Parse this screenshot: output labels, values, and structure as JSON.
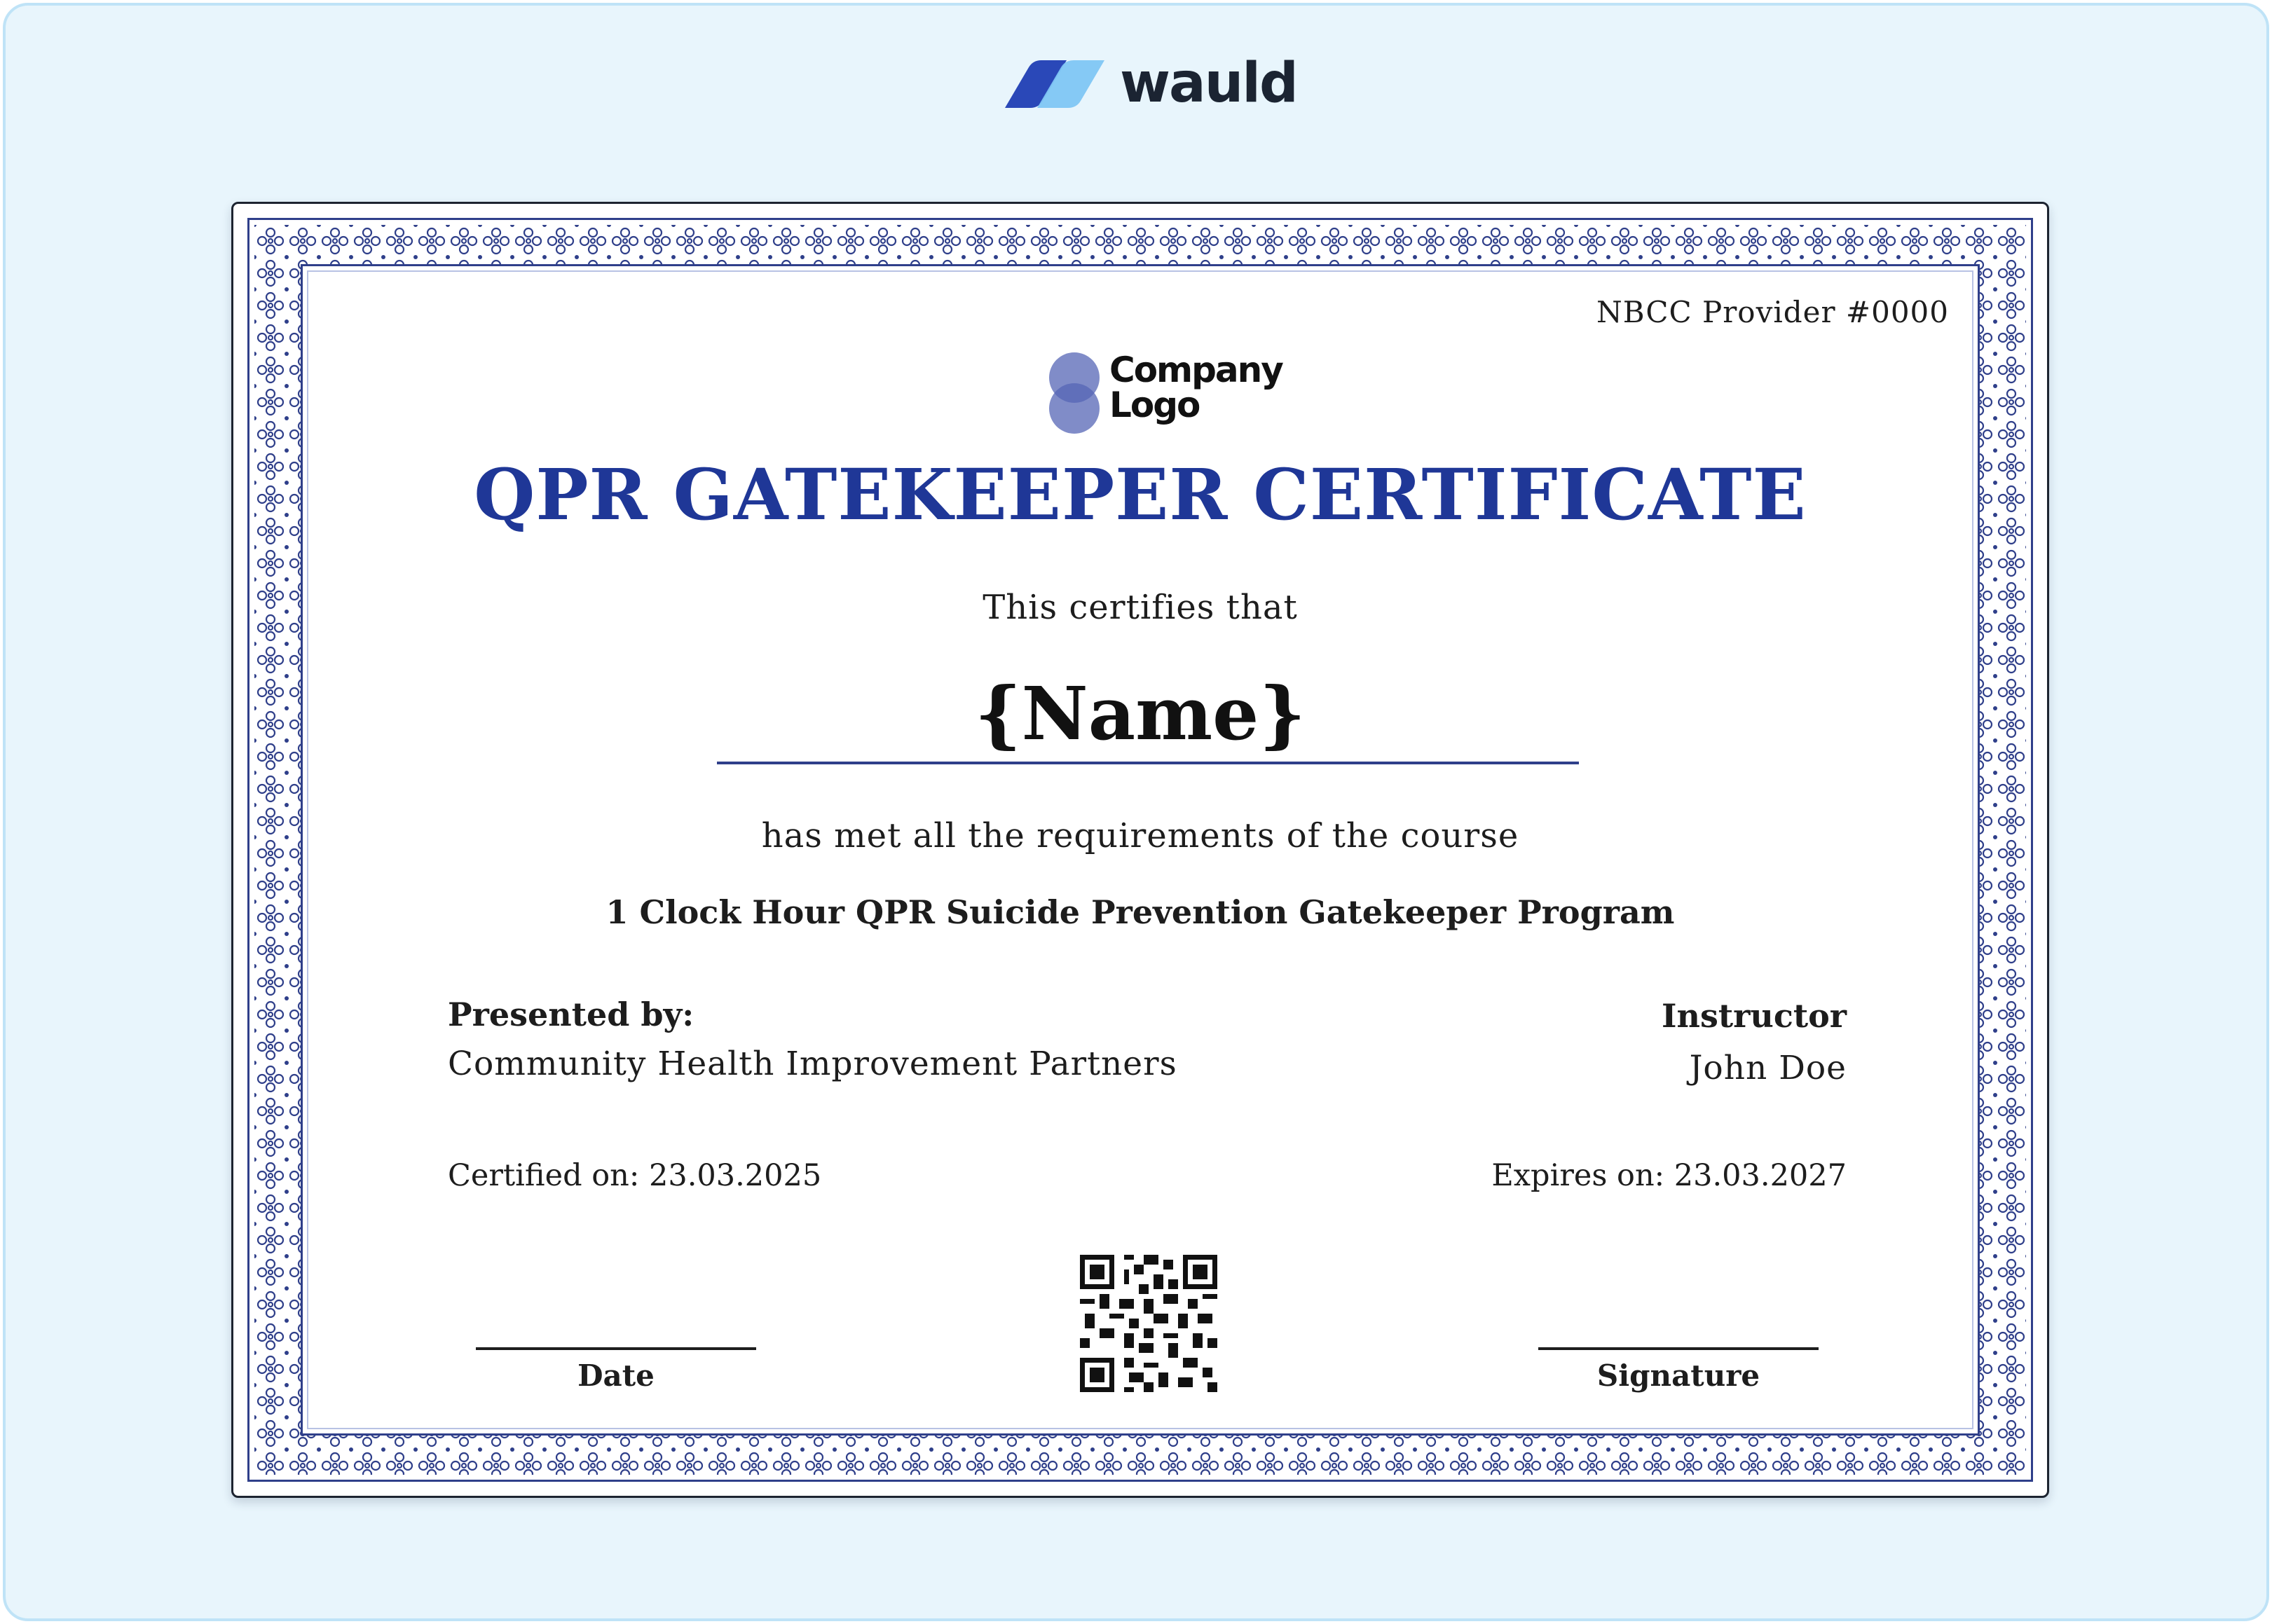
{
  "brand": {
    "name": "wauld",
    "colors": {
      "dark": "#2a48b8",
      "light": "#7fc6f4",
      "text": "#1b2432"
    }
  },
  "certificate": {
    "provider": "NBCC Provider #0000",
    "company_logo": {
      "line1": "Company",
      "line2": "Logo",
      "icon": "overlapping-circles-logo-icon"
    },
    "title": "QPR GATEKEEPER CERTIFICATE",
    "certifies_text": "This certifies that",
    "name": "{Name}",
    "requirements_text": "has met all the requirements of the course",
    "course": "1 Clock Hour QPR Suicide Prevention Gatekeeper Program",
    "presented_by": {
      "label": "Presented by:",
      "value": "Community Health Improvement Partners"
    },
    "instructor": {
      "label": "Instructor",
      "value": "John Doe"
    },
    "certified_on": "Certified on: 23.03.2025",
    "expires_on": "Expires on: 23.03.2027",
    "qr_icon": "qr-code-icon",
    "date_label": "Date",
    "signature_label": "Signature",
    "colors": {
      "title": "#1f3797",
      "border": "#2f3f8a",
      "page_background": "#e8f5fc"
    }
  }
}
